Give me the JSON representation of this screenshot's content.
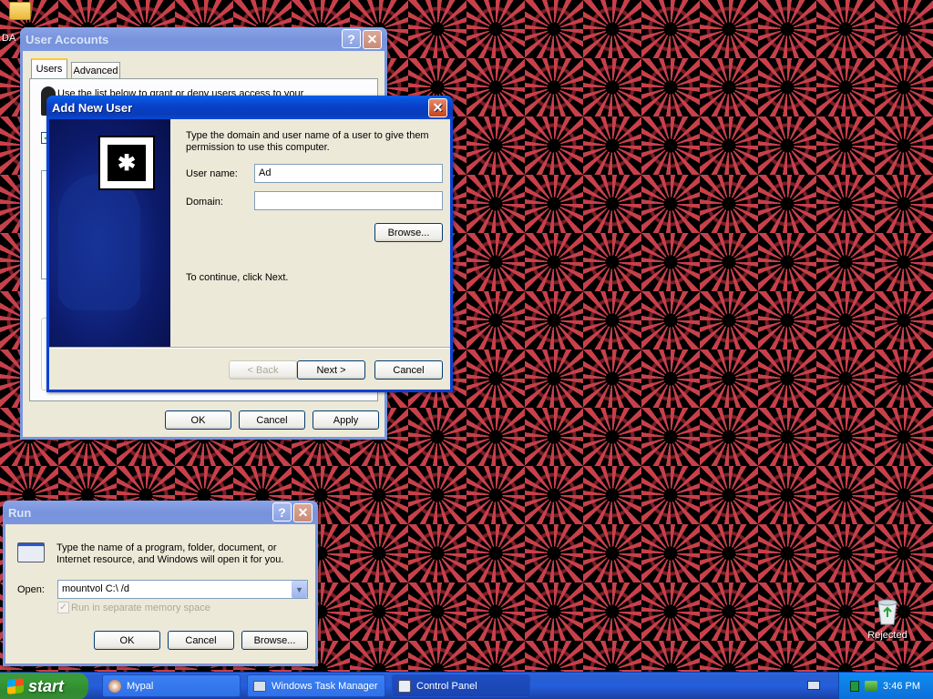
{
  "desktop": {
    "top_icon_label": "DA",
    "recycle_label": "Rejected"
  },
  "user_accounts": {
    "title": "User Accounts",
    "tabs": [
      "Users",
      "Advanced"
    ],
    "hidden_text": "Use the list below to grant or deny users access to your computer",
    "ok": "OK",
    "cancel": "Cancel",
    "apply": "Apply"
  },
  "add_user": {
    "title": "Add New User",
    "instruction": "Type the domain and user name of a user to give them permission to use this computer.",
    "username_label": "User name:",
    "username_value": "Ad",
    "domain_label": "Domain:",
    "domain_value": "",
    "browse": "Browse...",
    "continue_text": "To continue, click Next.",
    "back": "< Back",
    "next": "Next >",
    "cancel": "Cancel"
  },
  "run": {
    "title": "Run",
    "description": "Type the name of a program, folder, document, or Internet resource, and Windows will open it for you.",
    "open_label": "Open:",
    "open_value": "mountvol C:\\ /d",
    "checkbox_label": "Run in separate memory space",
    "ok": "OK",
    "cancel": "Cancel",
    "browse": "Browse..."
  },
  "taskbar": {
    "start": "start",
    "tasks": [
      "Mypal",
      "Windows Task Manager",
      "Control Panel"
    ],
    "clock": "3:46 PM"
  },
  "colors": {
    "title_active": "#0842d6",
    "title_inactive": "#7a96df",
    "window_face": "#ece9d8",
    "wallpaper_red": "#c8404a"
  }
}
